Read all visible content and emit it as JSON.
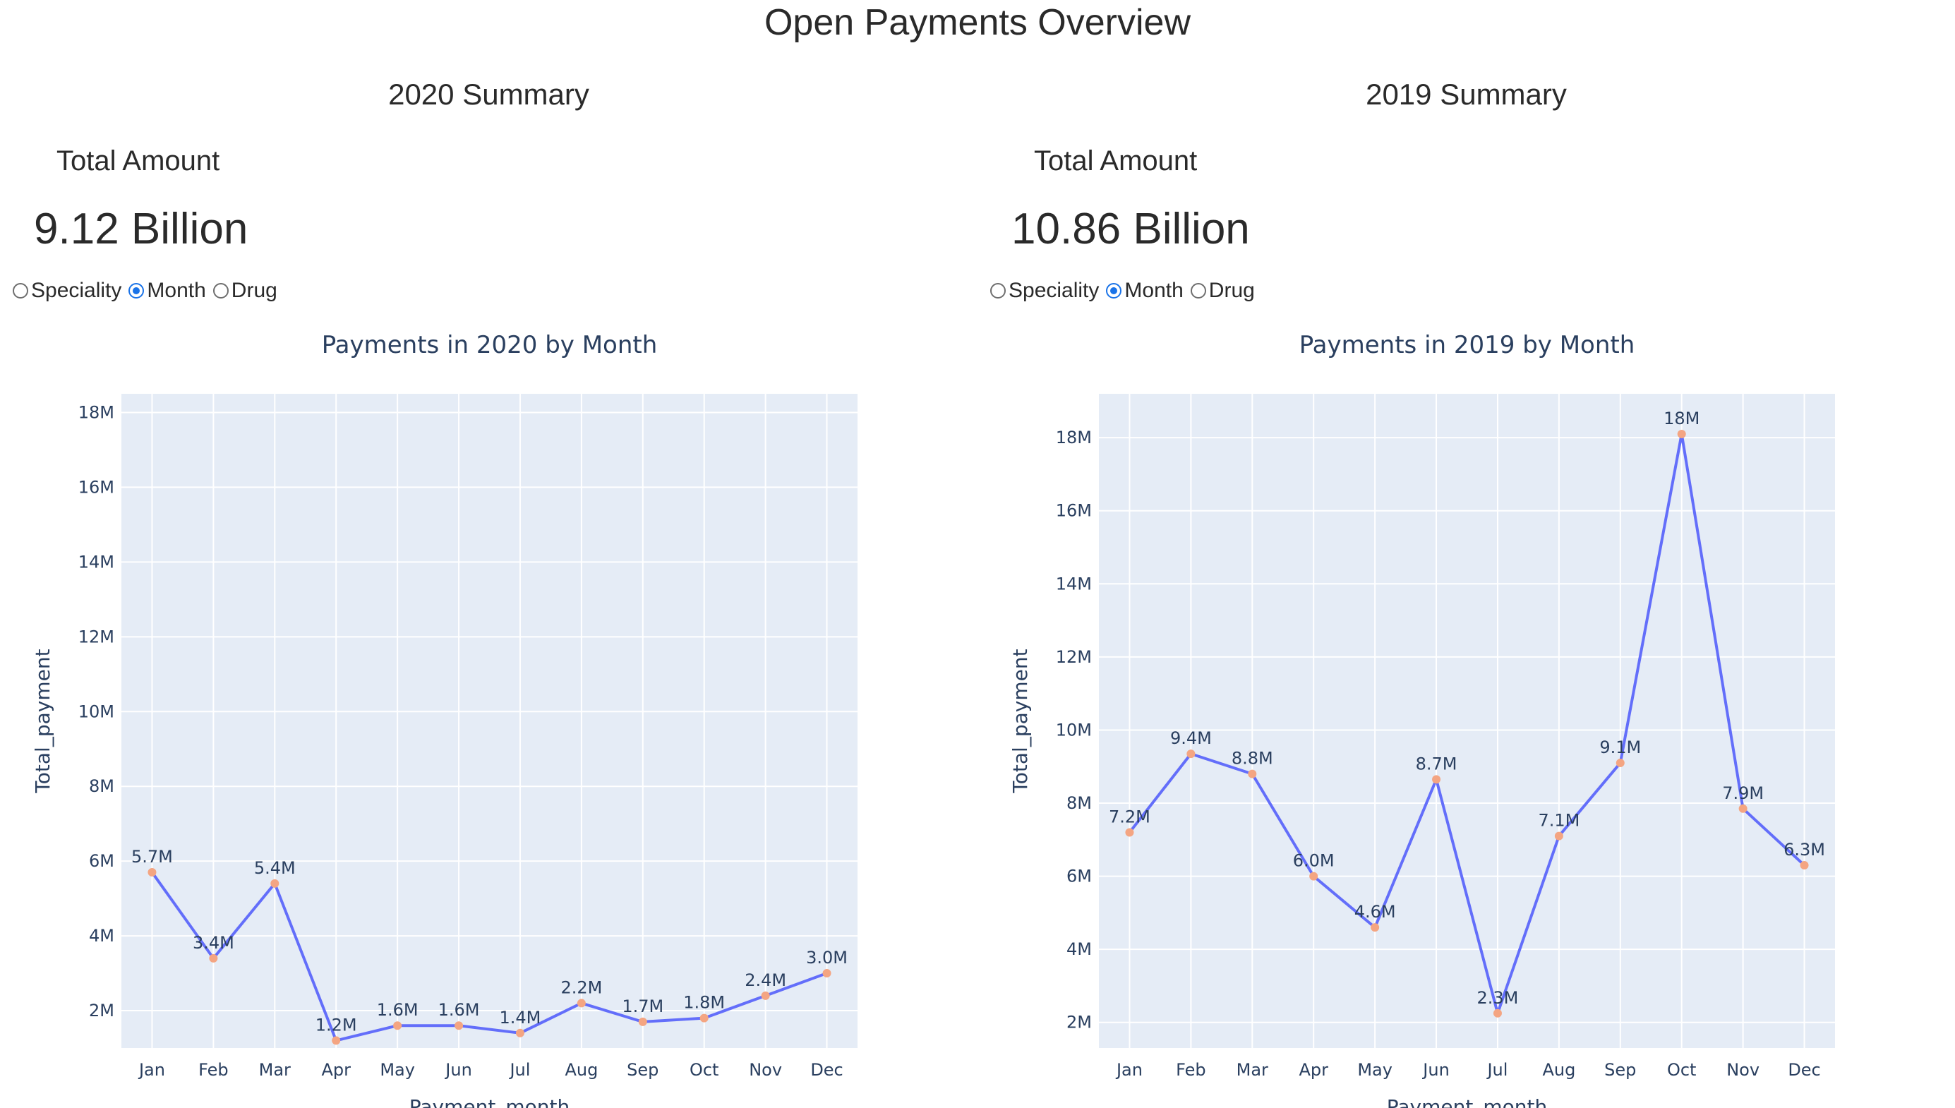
{
  "page_title": "Open Payments Overview",
  "panels": [
    {
      "summary_title": "2020 Summary",
      "total_label": "Total Amount",
      "total_value": "9.12 Billion",
      "options": [
        {
          "label": "Speciality",
          "selected": false
        },
        {
          "label": "Month",
          "selected": true
        },
        {
          "label": "Drug",
          "selected": false
        }
      ]
    },
    {
      "summary_title": "2019 Summary",
      "total_label": "Total Amount",
      "total_value": "10.86 Billion",
      "options": [
        {
          "label": "Speciality",
          "selected": false
        },
        {
          "label": "Month",
          "selected": true
        },
        {
          "label": "Drug",
          "selected": false
        }
      ]
    }
  ],
  "chart_data": [
    {
      "type": "line",
      "title": "Payments in 2020 by Month",
      "xlabel": "Payment_month",
      "ylabel": "Total_payment",
      "categories": [
        "Jan",
        "Feb",
        "Mar",
        "Apr",
        "May",
        "Jun",
        "Jul",
        "Aug",
        "Sep",
        "Oct",
        "Nov",
        "Dec"
      ],
      "values": [
        5.7,
        3.4,
        5.4,
        1.2,
        1.6,
        1.6,
        1.4,
        2.2,
        1.7,
        1.8,
        2.4,
        3.0
      ],
      "data_labels": [
        "5.7M",
        "3.4M",
        "5.4M",
        "1.2M",
        "1.6M",
        "1.6M",
        "1.4M",
        "2.2M",
        "1.7M",
        "1.8M",
        "2.4M",
        "3.0M"
      ],
      "value_unit": "M",
      "ylim": [
        1.0,
        18.5
      ],
      "yticks": [
        2,
        4,
        6,
        8,
        10,
        12,
        14,
        16,
        18
      ],
      "ytick_labels": [
        "2M",
        "4M",
        "6M",
        "8M",
        "10M",
        "12M",
        "14M",
        "16M",
        "18M"
      ],
      "grid": true,
      "line_color": "#636efa",
      "marker_color": "#f4a582",
      "plot_bg": "#e5ecf6",
      "title_color": "#2a3f5f"
    },
    {
      "type": "line",
      "title": "Payments in 2019 by Month",
      "xlabel": "Payment_month",
      "ylabel": "Total_payment",
      "categories": [
        "Jan",
        "Feb",
        "Mar",
        "Apr",
        "May",
        "Jun",
        "Jul",
        "Aug",
        "Sep",
        "Oct",
        "Nov",
        "Dec"
      ],
      "values": [
        7.2,
        9.35,
        8.8,
        6.0,
        4.6,
        8.65,
        2.25,
        7.1,
        9.1,
        18.1,
        7.85,
        6.3
      ],
      "data_labels": [
        "7.2M",
        "9.4M",
        "8.8M",
        "6.0M",
        "4.6M",
        "8.7M",
        "2.3M",
        "7.1M",
        "9.1M",
        "18M",
        "7.9M",
        "6.3M"
      ],
      "value_unit": "M",
      "ylim": [
        1.3,
        19.2
      ],
      "yticks": [
        2,
        4,
        6,
        8,
        10,
        12,
        14,
        16,
        18
      ],
      "ytick_labels": [
        "2M",
        "4M",
        "6M",
        "8M",
        "10M",
        "12M",
        "14M",
        "16M",
        "18M"
      ],
      "grid": true,
      "line_color": "#636efa",
      "marker_color": "#f4a582",
      "plot_bg": "#e5ecf6",
      "title_color": "#2a3f5f"
    }
  ]
}
